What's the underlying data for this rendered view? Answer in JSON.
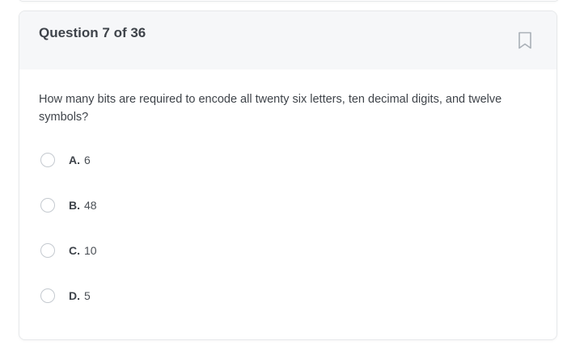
{
  "header": {
    "title": "Question 7 of 36",
    "bookmark_icon": "bookmark-icon"
  },
  "question": {
    "text": "How many bits are required to encode all twenty six letters, ten decimal digits, and twelve symbols?"
  },
  "options": [
    {
      "letter": "A.",
      "text": "6"
    },
    {
      "letter": "B.",
      "text": "48"
    },
    {
      "letter": "C.",
      "text": "10"
    },
    {
      "letter": "D.",
      "text": "5"
    }
  ],
  "colors": {
    "header_bg": "#f6f7f9",
    "border": "#e6e8ea",
    "radio_border": "#c4c9cf",
    "text": "#3f444a"
  }
}
